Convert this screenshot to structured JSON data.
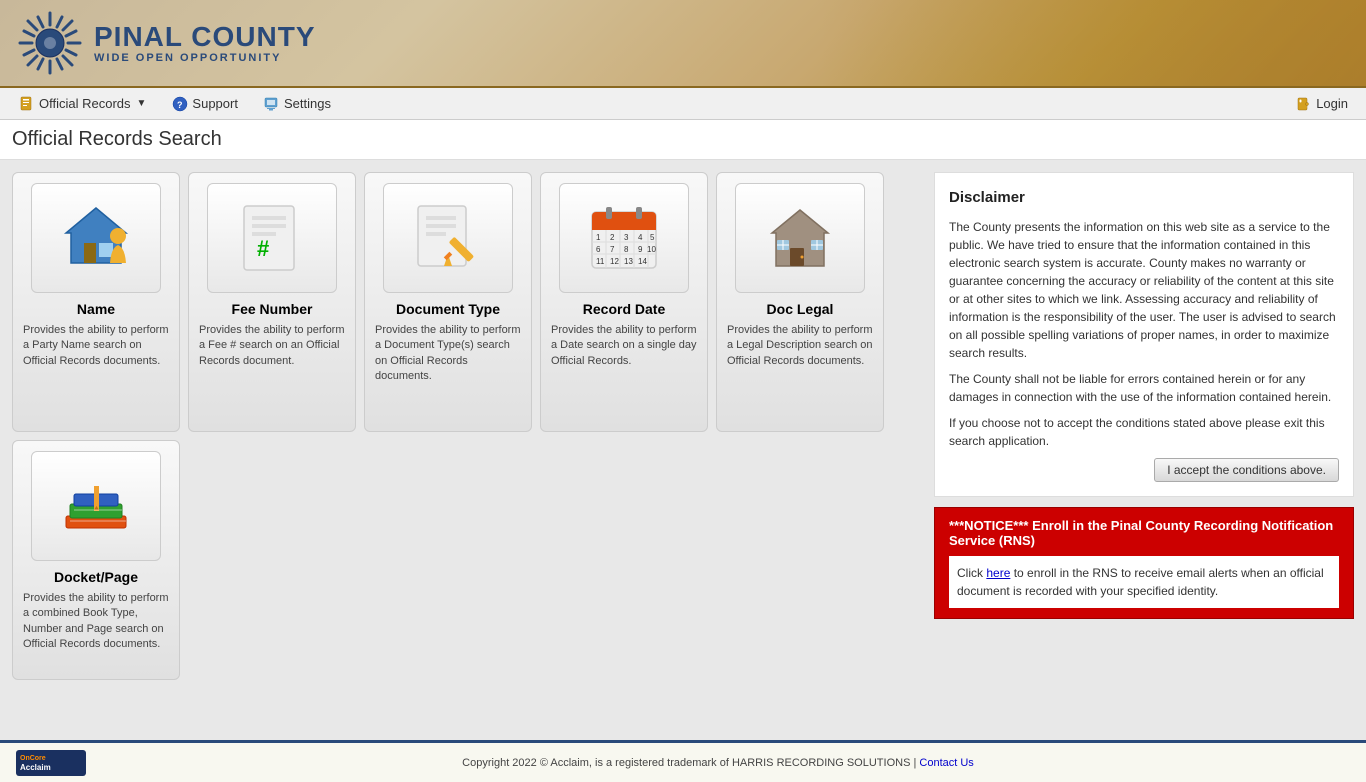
{
  "header": {
    "logo_text": "PINAL COUNTY",
    "logo_sub": "WIDE OPEN OPPORTUNITY"
  },
  "navbar": {
    "items": [
      {
        "id": "official-records",
        "label": "Official Records",
        "has_dropdown": true
      },
      {
        "id": "support",
        "label": "Support",
        "has_dropdown": false
      },
      {
        "id": "settings",
        "label": "Settings",
        "has_dropdown": false
      }
    ],
    "login_label": "Login"
  },
  "page_title": "Official Records Search",
  "search_cards": [
    {
      "id": "name",
      "title": "Name",
      "description": "Provides the ability to perform a Party Name search on Official Records documents."
    },
    {
      "id": "fee-number",
      "title": "Fee Number",
      "description": "Provides the ability to perform a Fee # search on an Official Records document."
    },
    {
      "id": "document-type",
      "title": "Document Type",
      "description": "Provides the ability to perform a Document Type(s) search on Official Records documents."
    },
    {
      "id": "record-date",
      "title": "Record Date",
      "description": "Provides the ability to perform a Date search on a single day Official Records."
    },
    {
      "id": "doc-legal",
      "title": "Doc Legal",
      "description": "Provides the ability to perform a Legal Description search on Official Records documents."
    }
  ],
  "search_cards_row2": [
    {
      "id": "docket-page",
      "title": "Docket/Page",
      "description": "Provides the ability to perform a combined Book Type, Number and Page search on Official Records documents."
    }
  ],
  "disclaimer": {
    "title": "Disclaimer",
    "paragraphs": [
      "The County presents the information on this web site as a service to the public. We have tried to ensure that the information contained in this electronic search system is accurate. County makes no warranty or guarantee concerning the accuracy or reliability of the content at this site or at other sites to which we link. Assessing accuracy and reliability of information is the responsibility of the user. The user is advised to search on all possible spelling variations of proper names, in order to maximize search results.",
      "The County shall not be liable for errors contained herein or for any damages in connection with the use of the information contained herein.",
      "If you choose not to accept the conditions stated above please exit this search application."
    ],
    "accept_button": "I accept the conditions above."
  },
  "notice": {
    "title": "***NOTICE*** Enroll in the Pinal County Recording Notification Service (RNS)",
    "body_before": "Click ",
    "link_text": "here",
    "body_after": " to enroll in the RNS to receive email alerts when an official document is recorded with your specified identity."
  },
  "footer": {
    "copyright": "Copyright 2022 © Acclaim, is a registered trademark of HARRIS RECORDING SOLUTIONS | ",
    "contact_label": "Contact Us",
    "brand": "OnCoreAcclaim"
  }
}
